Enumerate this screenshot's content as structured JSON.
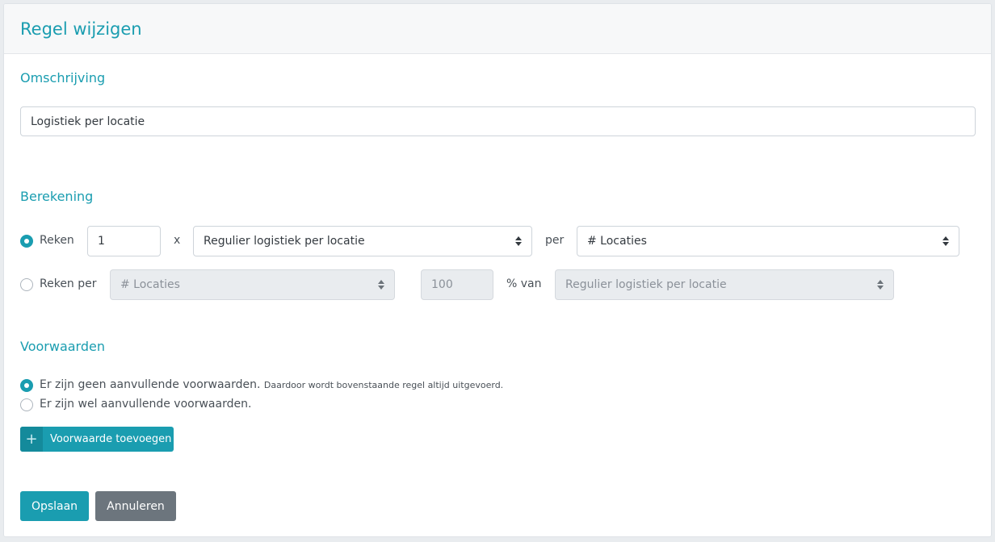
{
  "header": {
    "title": "Regel wijzigen"
  },
  "omschrijving": {
    "title": "Omschrijving",
    "value": "Logistiek per locatie"
  },
  "berekening": {
    "title": "Berekening",
    "row1": {
      "radio_label": "Reken",
      "checked": true,
      "quantity": "1",
      "multiply": "x",
      "select1": "Regulier logistiek per locatie",
      "per": "per",
      "select2": "# Locaties"
    },
    "row2": {
      "radio_label": "Reken per",
      "checked": false,
      "select1": "# Locaties",
      "percentage_placeholder": "100",
      "pct_label": "% van",
      "select2": "Regulier logistiek per locatie"
    }
  },
  "voorwaarden": {
    "title": "Voorwaarden",
    "option1": {
      "label": "Er zijn geen aanvullende voorwaarden.",
      "note": "Daardoor wordt bovenstaande regel altijd uitgevoerd.",
      "checked": true
    },
    "option2": {
      "label": "Er zijn wel aanvullende voorwaarden.",
      "checked": false
    },
    "add_button": {
      "icon": "plus-icon",
      "label": "Voorwaarde toevoegen"
    }
  },
  "footer": {
    "save_label": "Opslaan",
    "cancel_label": "Annuleren"
  },
  "colors": {
    "accent": "#1a9db0",
    "accent_dark": "#148a9b",
    "secondary": "#6c757d"
  }
}
